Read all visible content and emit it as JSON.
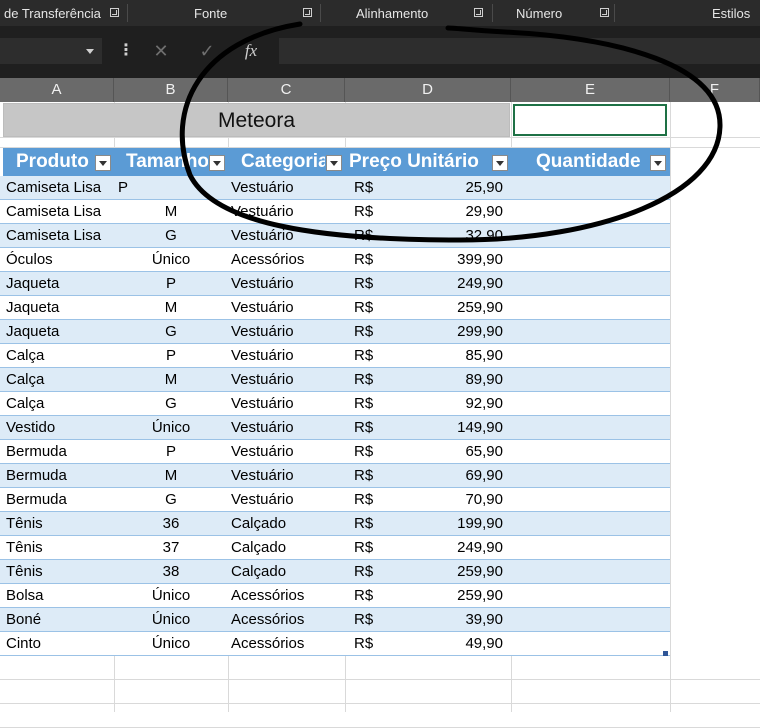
{
  "ribbon": {
    "groups": [
      "de Transferência",
      "Fonte",
      "Alinhamento",
      "Número",
      "Estilos"
    ]
  },
  "formula_bar": {
    "cancel_glyph": "✕",
    "enter_glyph": "✓",
    "fx_glyph": "fx"
  },
  "columns": [
    "A",
    "B",
    "C",
    "D",
    "E",
    "F"
  ],
  "title": "Meteora",
  "table": {
    "headers": [
      "Produto",
      "Tamanho",
      "Categoria",
      "Preço Unitário",
      "Quantidade"
    ],
    "rows": [
      [
        "Camiseta Lisa",
        "P",
        "Vestuário",
        "R$",
        "25,90"
      ],
      [
        "Camiseta Lisa",
        "M",
        "Vestuário",
        "R$",
        "29,90"
      ],
      [
        "Camiseta Lisa",
        "G",
        "Vestuário",
        "R$",
        "32,90"
      ],
      [
        "Óculos",
        "Único",
        "Acessórios",
        "R$",
        "399,90"
      ],
      [
        "Jaqueta",
        "P",
        "Vestuário",
        "R$",
        "249,90"
      ],
      [
        "Jaqueta",
        "M",
        "Vestuário",
        "R$",
        "259,90"
      ],
      [
        "Jaqueta",
        "G",
        "Vestuário",
        "R$",
        "299,90"
      ],
      [
        "Calça",
        "P",
        "Vestuário",
        "R$",
        "85,90"
      ],
      [
        "Calça",
        "M",
        "Vestuário",
        "R$",
        "89,90"
      ],
      [
        "Calça",
        "G",
        "Vestuário",
        "R$",
        "92,90"
      ],
      [
        "Vestido",
        "Único",
        "Vestuário",
        "R$",
        "149,90"
      ],
      [
        "Bermuda",
        "P",
        "Vestuário",
        "R$",
        "65,90"
      ],
      [
        "Bermuda",
        "M",
        "Vestuário",
        "R$",
        "69,90"
      ],
      [
        "Bermuda",
        "G",
        "Vestuário",
        "R$",
        "70,90"
      ],
      [
        "Tênis",
        "36",
        "Calçado",
        "R$",
        "199,90"
      ],
      [
        "Tênis",
        "37",
        "Calçado",
        "R$",
        "249,90"
      ],
      [
        "Tênis",
        "38",
        "Calçado",
        "R$",
        "259,90"
      ],
      [
        "Bolsa",
        "Único",
        "Acessórios",
        "R$",
        "259,90"
      ],
      [
        "Boné",
        "Único",
        "Acessórios",
        "R$",
        "39,90"
      ],
      [
        "Cinto",
        "Único",
        "Acessórios",
        "R$",
        "49,90"
      ]
    ]
  },
  "colors": {
    "ribbon_bg": "#2b2b2b",
    "header_band": "#5b9bd5",
    "row_band": "#ddebf7",
    "title_fill": "#c6c6c6",
    "selection": "#1e7145",
    "annotation_stroke": "#000000"
  }
}
